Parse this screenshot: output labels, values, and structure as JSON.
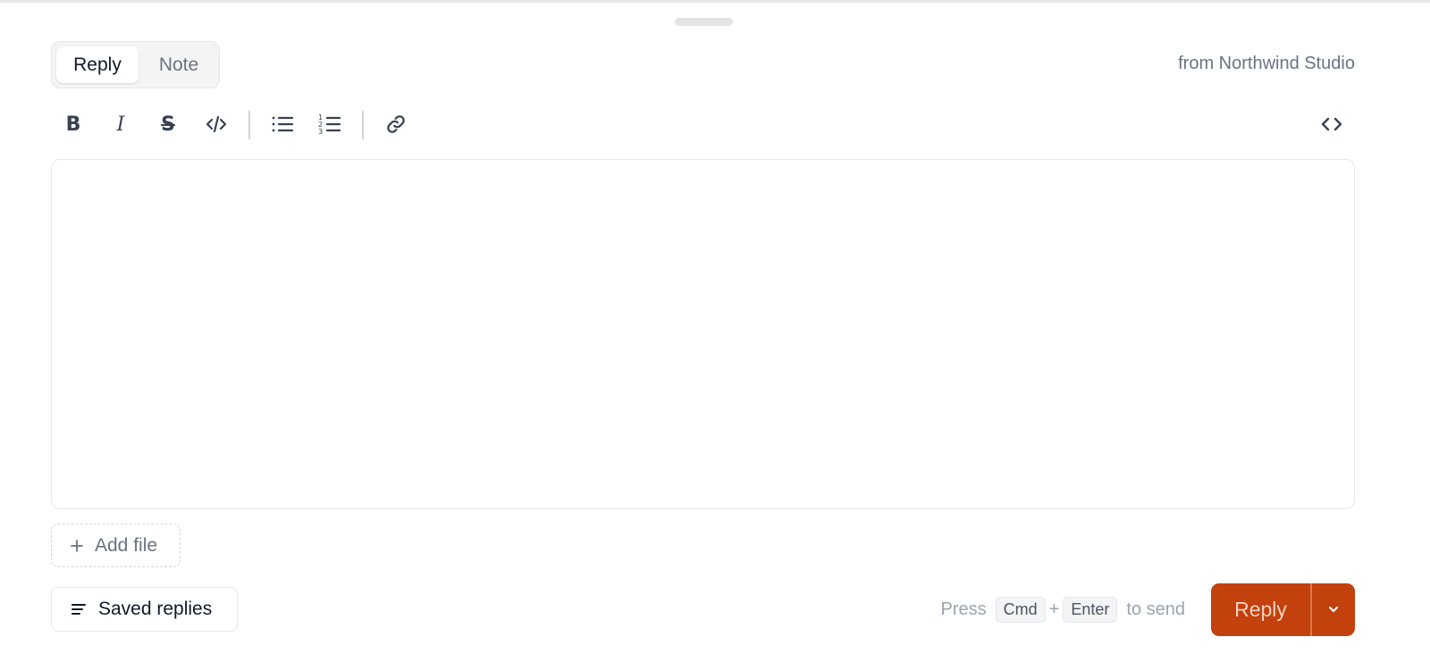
{
  "composer": {
    "tabs": [
      {
        "label": "Reply",
        "active": true
      },
      {
        "label": "Note",
        "active": false
      }
    ],
    "from_label": "from Northwind Studio",
    "toolbar": {
      "buttons": [
        "bold-icon",
        "italic-icon",
        "strikethrough-icon",
        "code-icon",
        "bullet-list-icon",
        "numbered-list-icon",
        "link-icon",
        "source-code-icon"
      ],
      "bold_glyph": "B",
      "italic_glyph": "I",
      "strike_glyph": "S"
    },
    "editor": {
      "value": ""
    },
    "add_file_label": "Add file",
    "saved_replies_label": "Saved replies",
    "send_hint": {
      "prefix": "Press",
      "key1": "Cmd",
      "plus": "+",
      "key2": "Enter",
      "suffix": "to send"
    },
    "reply_button_label": "Reply"
  },
  "colors": {
    "accent": "#c2410c",
    "accent_text": "#f3d2bf",
    "border": "#e5e7eb",
    "muted_text": "#6b7280"
  }
}
